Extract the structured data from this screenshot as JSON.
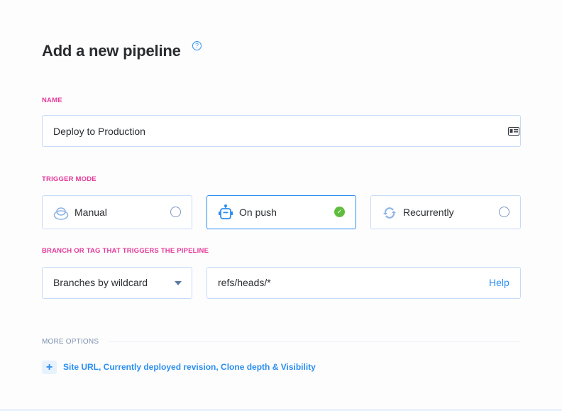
{
  "title": "Add a new pipeline",
  "help_icon": "question-circle-icon",
  "name": {
    "label": "NAME",
    "value": "Deploy to Production",
    "icon": "id-card-icon"
  },
  "trigger": {
    "label": "TRIGGER MODE",
    "options": [
      {
        "label": "Manual",
        "icon": "push-button-icon",
        "selected": false
      },
      {
        "label": "On push",
        "icon": "robot-icon",
        "selected": true
      },
      {
        "label": "Recurrently",
        "icon": "refresh-icon",
        "selected": false
      }
    ]
  },
  "branch": {
    "label": "BRANCH OR TAG THAT TRIGGERS THE PIPELINE",
    "select_value": "Branches by wildcard",
    "pattern_value": "refs/heads/*",
    "help_link": "Help"
  },
  "more_options": {
    "label": "MORE OPTIONS",
    "link": "Site URL, Currently deployed revision, Clone depth & Visibility"
  },
  "colors": {
    "accent": "#2b8ef0",
    "label": "#e5399a",
    "success": "#5fbd3d"
  }
}
